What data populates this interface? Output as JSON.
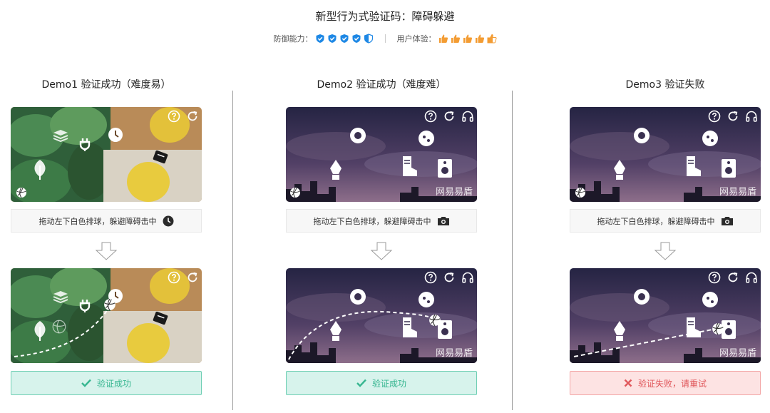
{
  "page": {
    "title": "新型行为式验证码：障碍躲避",
    "defense_label": "防御能力：",
    "experience_label": "用户体验：",
    "defense_level": 4.5,
    "experience_level": 4.5,
    "colors": {
      "shield": "#1e88e5",
      "thumb": "#f39c33",
      "success": "#36b690",
      "fail": "#e0575b"
    }
  },
  "demos": [
    {
      "title": "Demo1 验证成功（难度易）",
      "hint": "拖动左下白色排球，躲避障碍击中",
      "hint_icon": "clock-icon",
      "result": "验证成功",
      "result_icon": "check-icon",
      "status": "success"
    },
    {
      "title": "Demo2 验证成功（难度难）",
      "hint": "拖动左下白色排球，躲避障碍击中",
      "hint_icon": "camera-icon",
      "result": "验证成功",
      "result_icon": "check-icon",
      "status": "success",
      "brand": "网易易盾"
    },
    {
      "title": "Demo3 验证失败",
      "hint": "拖动左下白色排球，躲避障碍击中",
      "hint_icon": "camera-icon",
      "result": "验证失败，请重试",
      "result_icon": "x-icon",
      "status": "fail",
      "brand": "网易易盾"
    }
  ]
}
